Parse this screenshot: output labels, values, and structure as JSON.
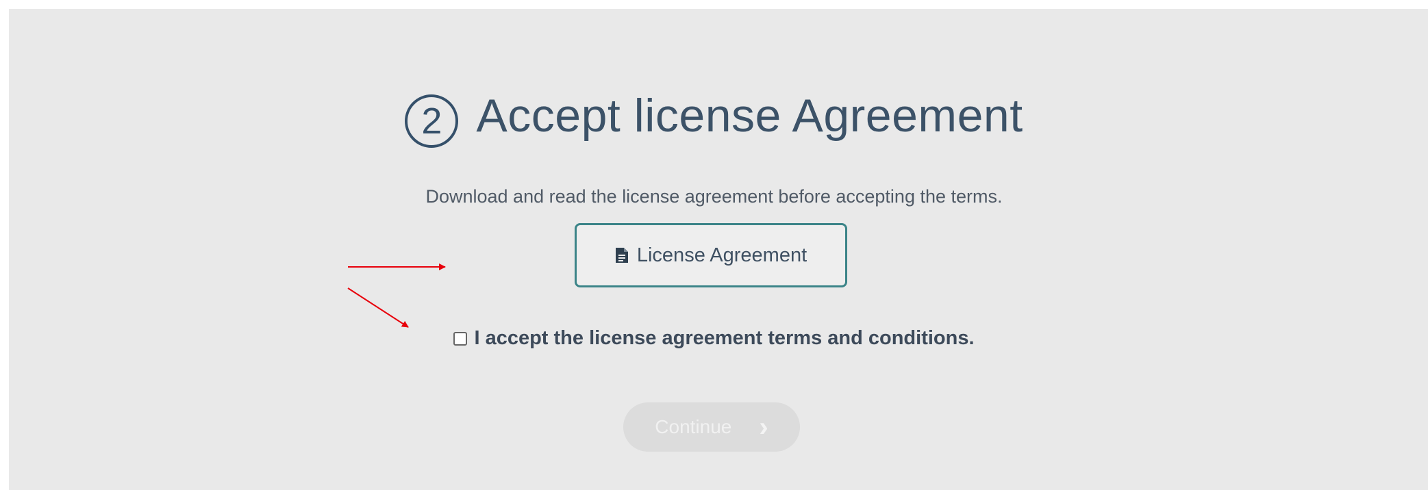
{
  "step": {
    "number": "2",
    "title": "Accept license Agreement",
    "description": "Download and read the license agreement before accepting the terms."
  },
  "license_button": {
    "label": "License Agreement",
    "icon": "document-icon"
  },
  "accept": {
    "label": "I accept the license agreement terms and conditions.",
    "checked": false
  },
  "continue_button": {
    "label": "Continue",
    "icon": "chevron-right-icon",
    "disabled": true
  },
  "annotation_color": "#e8000b",
  "accent_color": "#3b8488"
}
